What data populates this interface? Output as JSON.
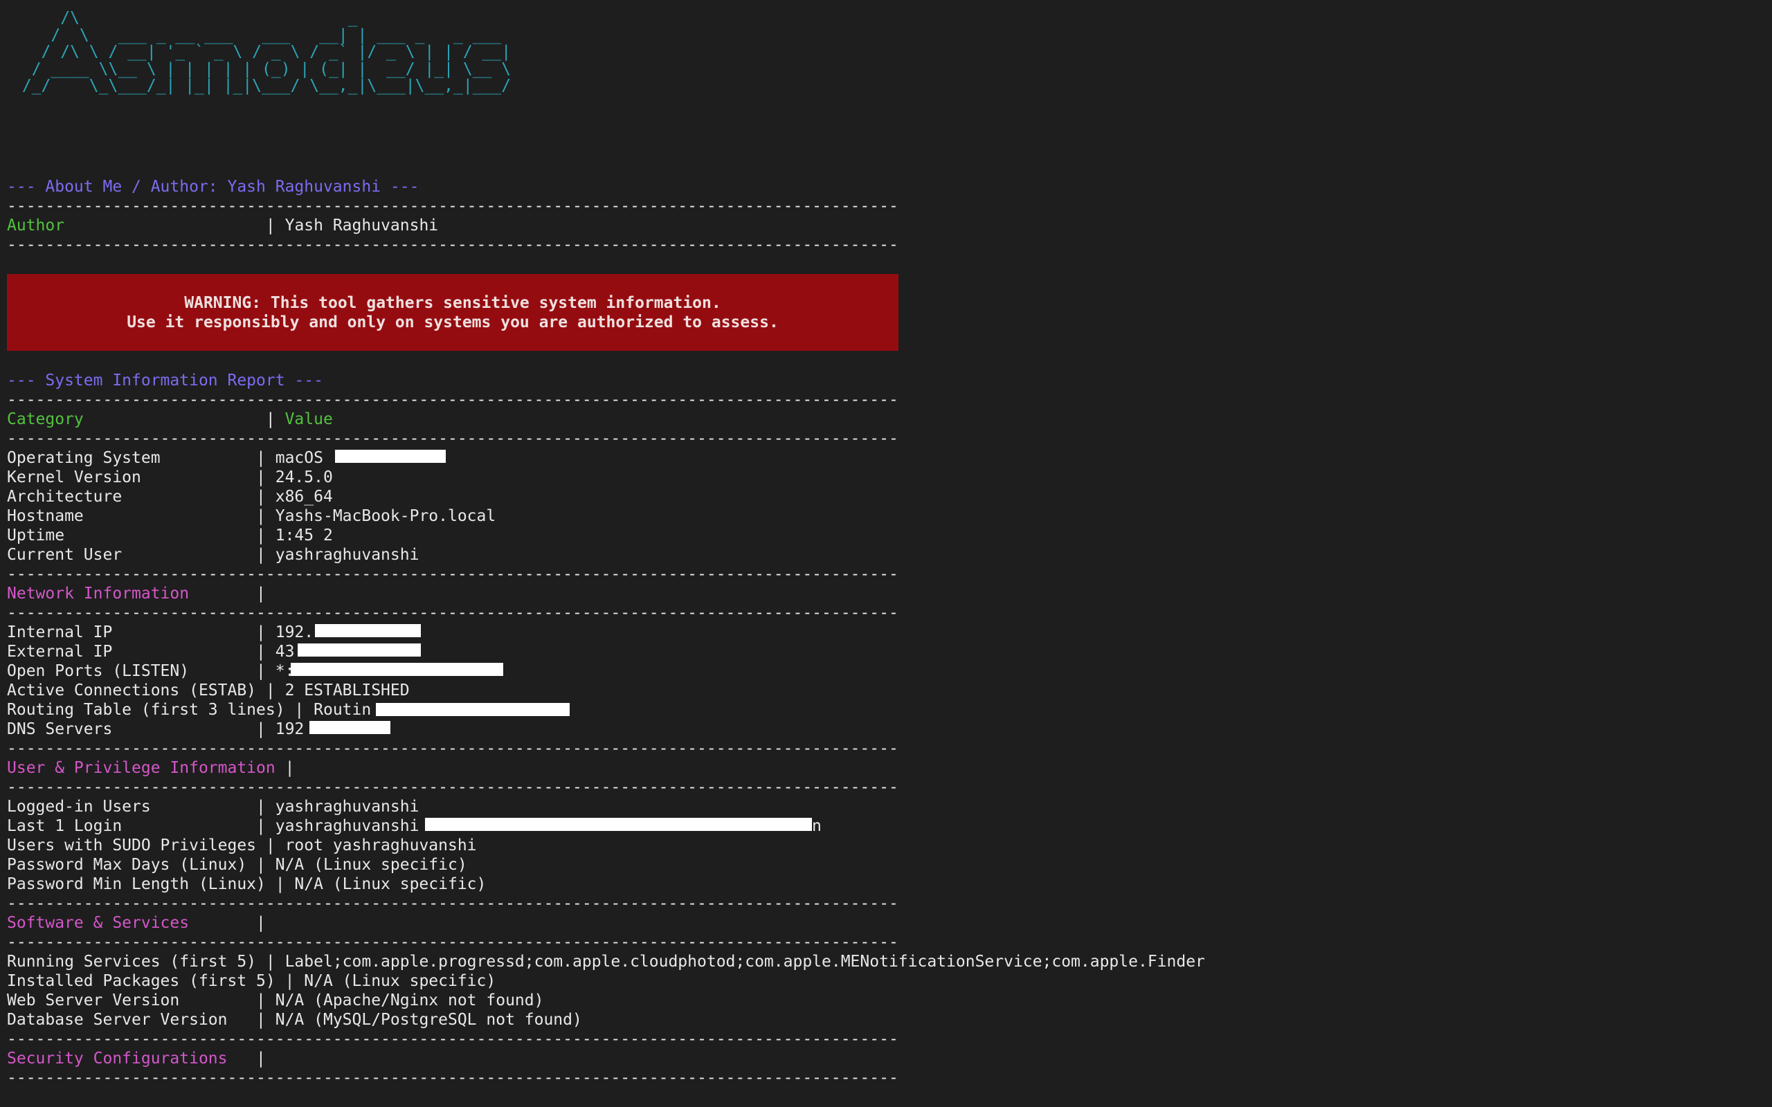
{
  "banner": {
    "ascii_art": "     /\\                            _\n    /  \\   ___ _ __ ___   ___   __| | ___ _   _ ___\n   / /\\ \\ / __| '_ ` _ \\ / _ \\ / _` |/ _ \\ | | / __|\n  / ____ \\\\__ \\ | | | | | (_) | (_| |  __/ |_| \\__ \\\n /_/    \\_\\___/_| |_| |_|\\___/ \\__,_|\\___|\\__,_|___/"
  },
  "about": {
    "heading": "--- About Me / Author: Yash Raghuvanshi ---",
    "rows": [
      {
        "key": "Author",
        "pad": "                    ",
        "value": "Yash Raghuvanshi"
      }
    ]
  },
  "divider": "---------------------------------------------------------------------------------------------",
  "warning": {
    "line1": "WARNING: This tool gathers sensitive system information.",
    "line2": "Use it responsibly and only on systems you are authorized to assess."
  },
  "report": {
    "heading": "--- System Information Report ---",
    "header_category": "Category",
    "header_value": "Value",
    "system_rows": [
      {
        "key": "Operating System          ",
        "value": "macOS "
      },
      {
        "key": "Kernel Version            ",
        "value": "24.5.0"
      },
      {
        "key": "Architecture              ",
        "value": "x86_64"
      },
      {
        "key": "Hostname                  ",
        "value": "Yashs-MacBook-Pro.local"
      },
      {
        "key": "Uptime                    ",
        "value": "1:45 2"
      },
      {
        "key": "Current User              ",
        "value": "yashraghuvanshi"
      }
    ],
    "network_title": "Network Information       ",
    "network_rows": [
      {
        "key": "Internal IP               ",
        "value": "192."
      },
      {
        "key": "External IP               ",
        "value": "43"
      },
      {
        "key": "Open Ports (LISTEN)       ",
        "value": "*:"
      },
      {
        "key": "Active Connections (ESTAB)",
        "value": "2 ESTABLISHED"
      },
      {
        "key": "Routing Table (first 3 lines)",
        "value": "Routin"
      },
      {
        "key": "DNS Servers               ",
        "value": "192"
      }
    ],
    "user_title": "User & Privilege Information",
    "user_rows": [
      {
        "key": "Logged-in Users           ",
        "value": "yashraghuvanshi"
      },
      {
        "key": "Last 1 Login              ",
        "value": "yashraghuvanshi",
        "tail": "n"
      },
      {
        "key": "Users with SUDO Privileges",
        "value": "root yashraghuvanshi"
      },
      {
        "key": "Password Max Days (Linux)",
        "value": "N/A (Linux specific)"
      },
      {
        "key": "Password Min Length (Linux)",
        "value": "N/A (Linux specific)"
      }
    ],
    "software_title": "Software & Services       ",
    "software_rows": [
      {
        "key": "Running Services (first 5)",
        "value": "Label;com.apple.progressd;com.apple.cloudphotod;com.apple.MENotificationService;com.apple.Finder"
      },
      {
        "key": "Installed Packages (first 5)",
        "value": "N/A (Linux specific)"
      },
      {
        "key": "Web Server Version        ",
        "value": "N/A (Apache/Nginx not found)"
      },
      {
        "key": "Database Server Version   ",
        "value": "N/A (MySQL/PostgreSQL not found)"
      }
    ],
    "security_title": "Security Configurations   "
  }
}
